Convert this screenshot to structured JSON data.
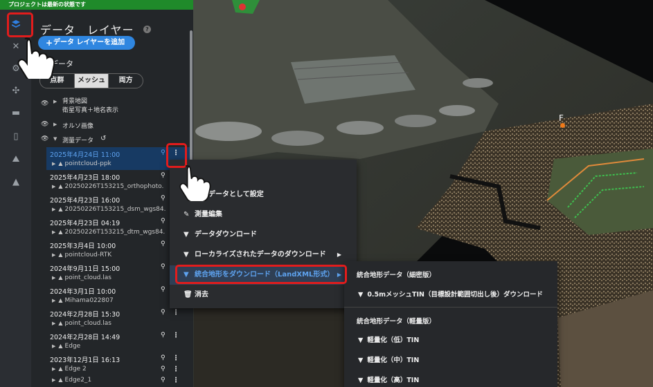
{
  "status_bar": {
    "text": "プロジェクトは最新の状態です"
  },
  "rail": {
    "icons": [
      "layers-icon",
      "tools-icon",
      "settings-icon",
      "drone-icon",
      "folder-icon",
      "device-icon",
      "map-icon",
      "stack-icon"
    ]
  },
  "panel": {
    "title": "データ　レイヤー",
    "help": "?",
    "add_layer_label": "データ レイヤーを追加",
    "data_heading": "データ",
    "segments": [
      "点群",
      "メッシュ",
      "両方"
    ],
    "selected_segment": "メッシュ",
    "base_map": {
      "label": "背景地図",
      "sub": "衛星写真＋地名表示"
    },
    "ortho": {
      "label": "オルソ画像"
    },
    "survey": {
      "label": "測量データ"
    },
    "entries": [
      {
        "date": "2025年4月24日 11:00",
        "item": "pointcloud-ppk",
        "selected": true
      },
      {
        "date": "2025年4月23日 18:00",
        "item": "20250226T153215_orthophoto."
      },
      {
        "date": "2025年4月23日 16:00",
        "item": "20250226T153215_dsm_wgs84."
      },
      {
        "date": "2025年4月23日 04:19",
        "item": "20250226T153215_dtm_wgs84."
      },
      {
        "date": "2025年3月4日 10:00",
        "item": "pointcloud-RTK"
      },
      {
        "date": "2024年9月11日 15:00",
        "item": "point_cloud.las"
      },
      {
        "date": "2024年3月1日 10:00",
        "item": "Mihama022807"
      },
      {
        "date": "2024年2月28日 15:30",
        "item": "point_cloud.las"
      },
      {
        "date": "2024年2月28日 14:49",
        "item": "Edge"
      },
      {
        "date": "2023年12月1日 16:13",
        "item": "Edge 2",
        "item2": "Edge2_1"
      }
    ]
  },
  "context_menu": {
    "items": [
      {
        "icon": "flag-icon",
        "label": "地形データとして設定",
        "display": "地形データとして設定"
      },
      {
        "icon": "pencil-icon",
        "label": "測量編集"
      },
      {
        "icon": "file-download-icon",
        "label": "データダウンロード"
      },
      {
        "icon": "file-download-icon",
        "label": "ローカライズされたデータのダウンロード",
        "has_sub": true
      },
      {
        "icon": "file-download-icon",
        "label": "統合地形をダウンロード（LandXML形式）",
        "has_sub": true,
        "highlighted": true
      },
      {
        "icon": "trash-icon",
        "label": "消去"
      }
    ]
  },
  "sub_menu": {
    "group1": "統合地形データ（細密版）",
    "group1_items": [
      "0.5mメッシュTIN（目標設計範囲切出し後）ダウンロード"
    ],
    "group2": "統合地形データ（軽量版）",
    "group2_items": [
      "軽量化（低）TIN",
      "軽量化（中）TIN",
      "軽量化（高）TIN"
    ]
  },
  "scene": {
    "marker_label": "F"
  },
  "colors": {
    "accent": "#2f86e0",
    "highlight_border": "#e21c1c",
    "status_green": "#1f8a2a"
  }
}
